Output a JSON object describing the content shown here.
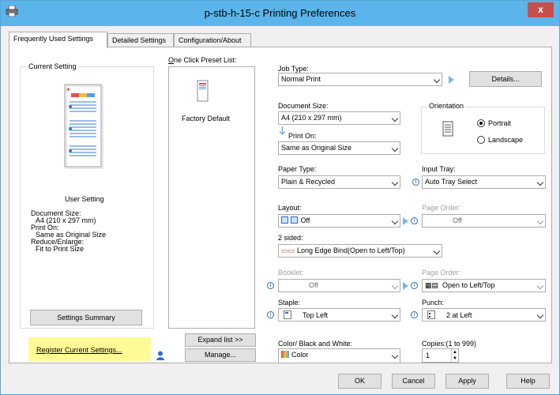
{
  "window": {
    "title": "p-stb-h-15-c Printing Preferences",
    "close_glyph": "x"
  },
  "tabs": [
    "Frequently Used Settings",
    "Detailed Settings",
    "Configuration/About"
  ],
  "current_setting": {
    "group_label": "Current Setting",
    "user_setting": "User Setting",
    "summary_lines": [
      "Document Size:",
      "A4 (210 x 297 mm)",
      "Print On:",
      "Same as Original Size",
      "Reduce/Enlarge:",
      "Fit to Print Size"
    ],
    "settings_summary_button": "Settings Summary",
    "register_button": "Register Current Settings..."
  },
  "preset": {
    "label": "One Click Preset List:",
    "items": [
      "Factory Default"
    ],
    "expand_button": "Expand list >>",
    "manage_button": "Manage..."
  },
  "job_type": {
    "label": "Job Type:",
    "value": "Normal Print",
    "details_button": "Details..."
  },
  "document_size": {
    "label": "Document Size:",
    "value": "A4 (210 x 297 mm)"
  },
  "print_on": {
    "label": "Print On:",
    "value": "Same as Original Size"
  },
  "orientation": {
    "label": "Orientation",
    "portrait": "Portrait",
    "landscape": "Landscape",
    "selected": "Portrait"
  },
  "paper_type": {
    "label": "Paper Type:",
    "value": "Plain & Recycled"
  },
  "input_tray": {
    "label": "Input Tray:",
    "value": "Auto Tray Select"
  },
  "layout": {
    "label": "Layout:",
    "value": "Off"
  },
  "page_order_1": {
    "label": "Page Order:",
    "value": "Off"
  },
  "two_sided": {
    "label": "2 sided:",
    "value": "Long Edge Bind(Open to Left/Top)"
  },
  "booklet": {
    "label": "Booklet:",
    "value": "Off"
  },
  "page_order_2": {
    "label": "Page Order:",
    "value": "Open to Left/Top"
  },
  "staple": {
    "label": "Staple:",
    "value": "Top Left"
  },
  "punch": {
    "label": "Punch:",
    "value": "2 at Left"
  },
  "color": {
    "label": "Color/ Black and White:",
    "value": "Color"
  },
  "copies": {
    "label": "Copies:(1 to 999)",
    "value": "1"
  },
  "footer": {
    "ok": "OK",
    "cancel": "Cancel",
    "apply": "Apply",
    "help": "Help"
  },
  "colors": {
    "titlebar": "#5bb4ea",
    "close": "#c7504c",
    "highlight": "#fffb96"
  }
}
